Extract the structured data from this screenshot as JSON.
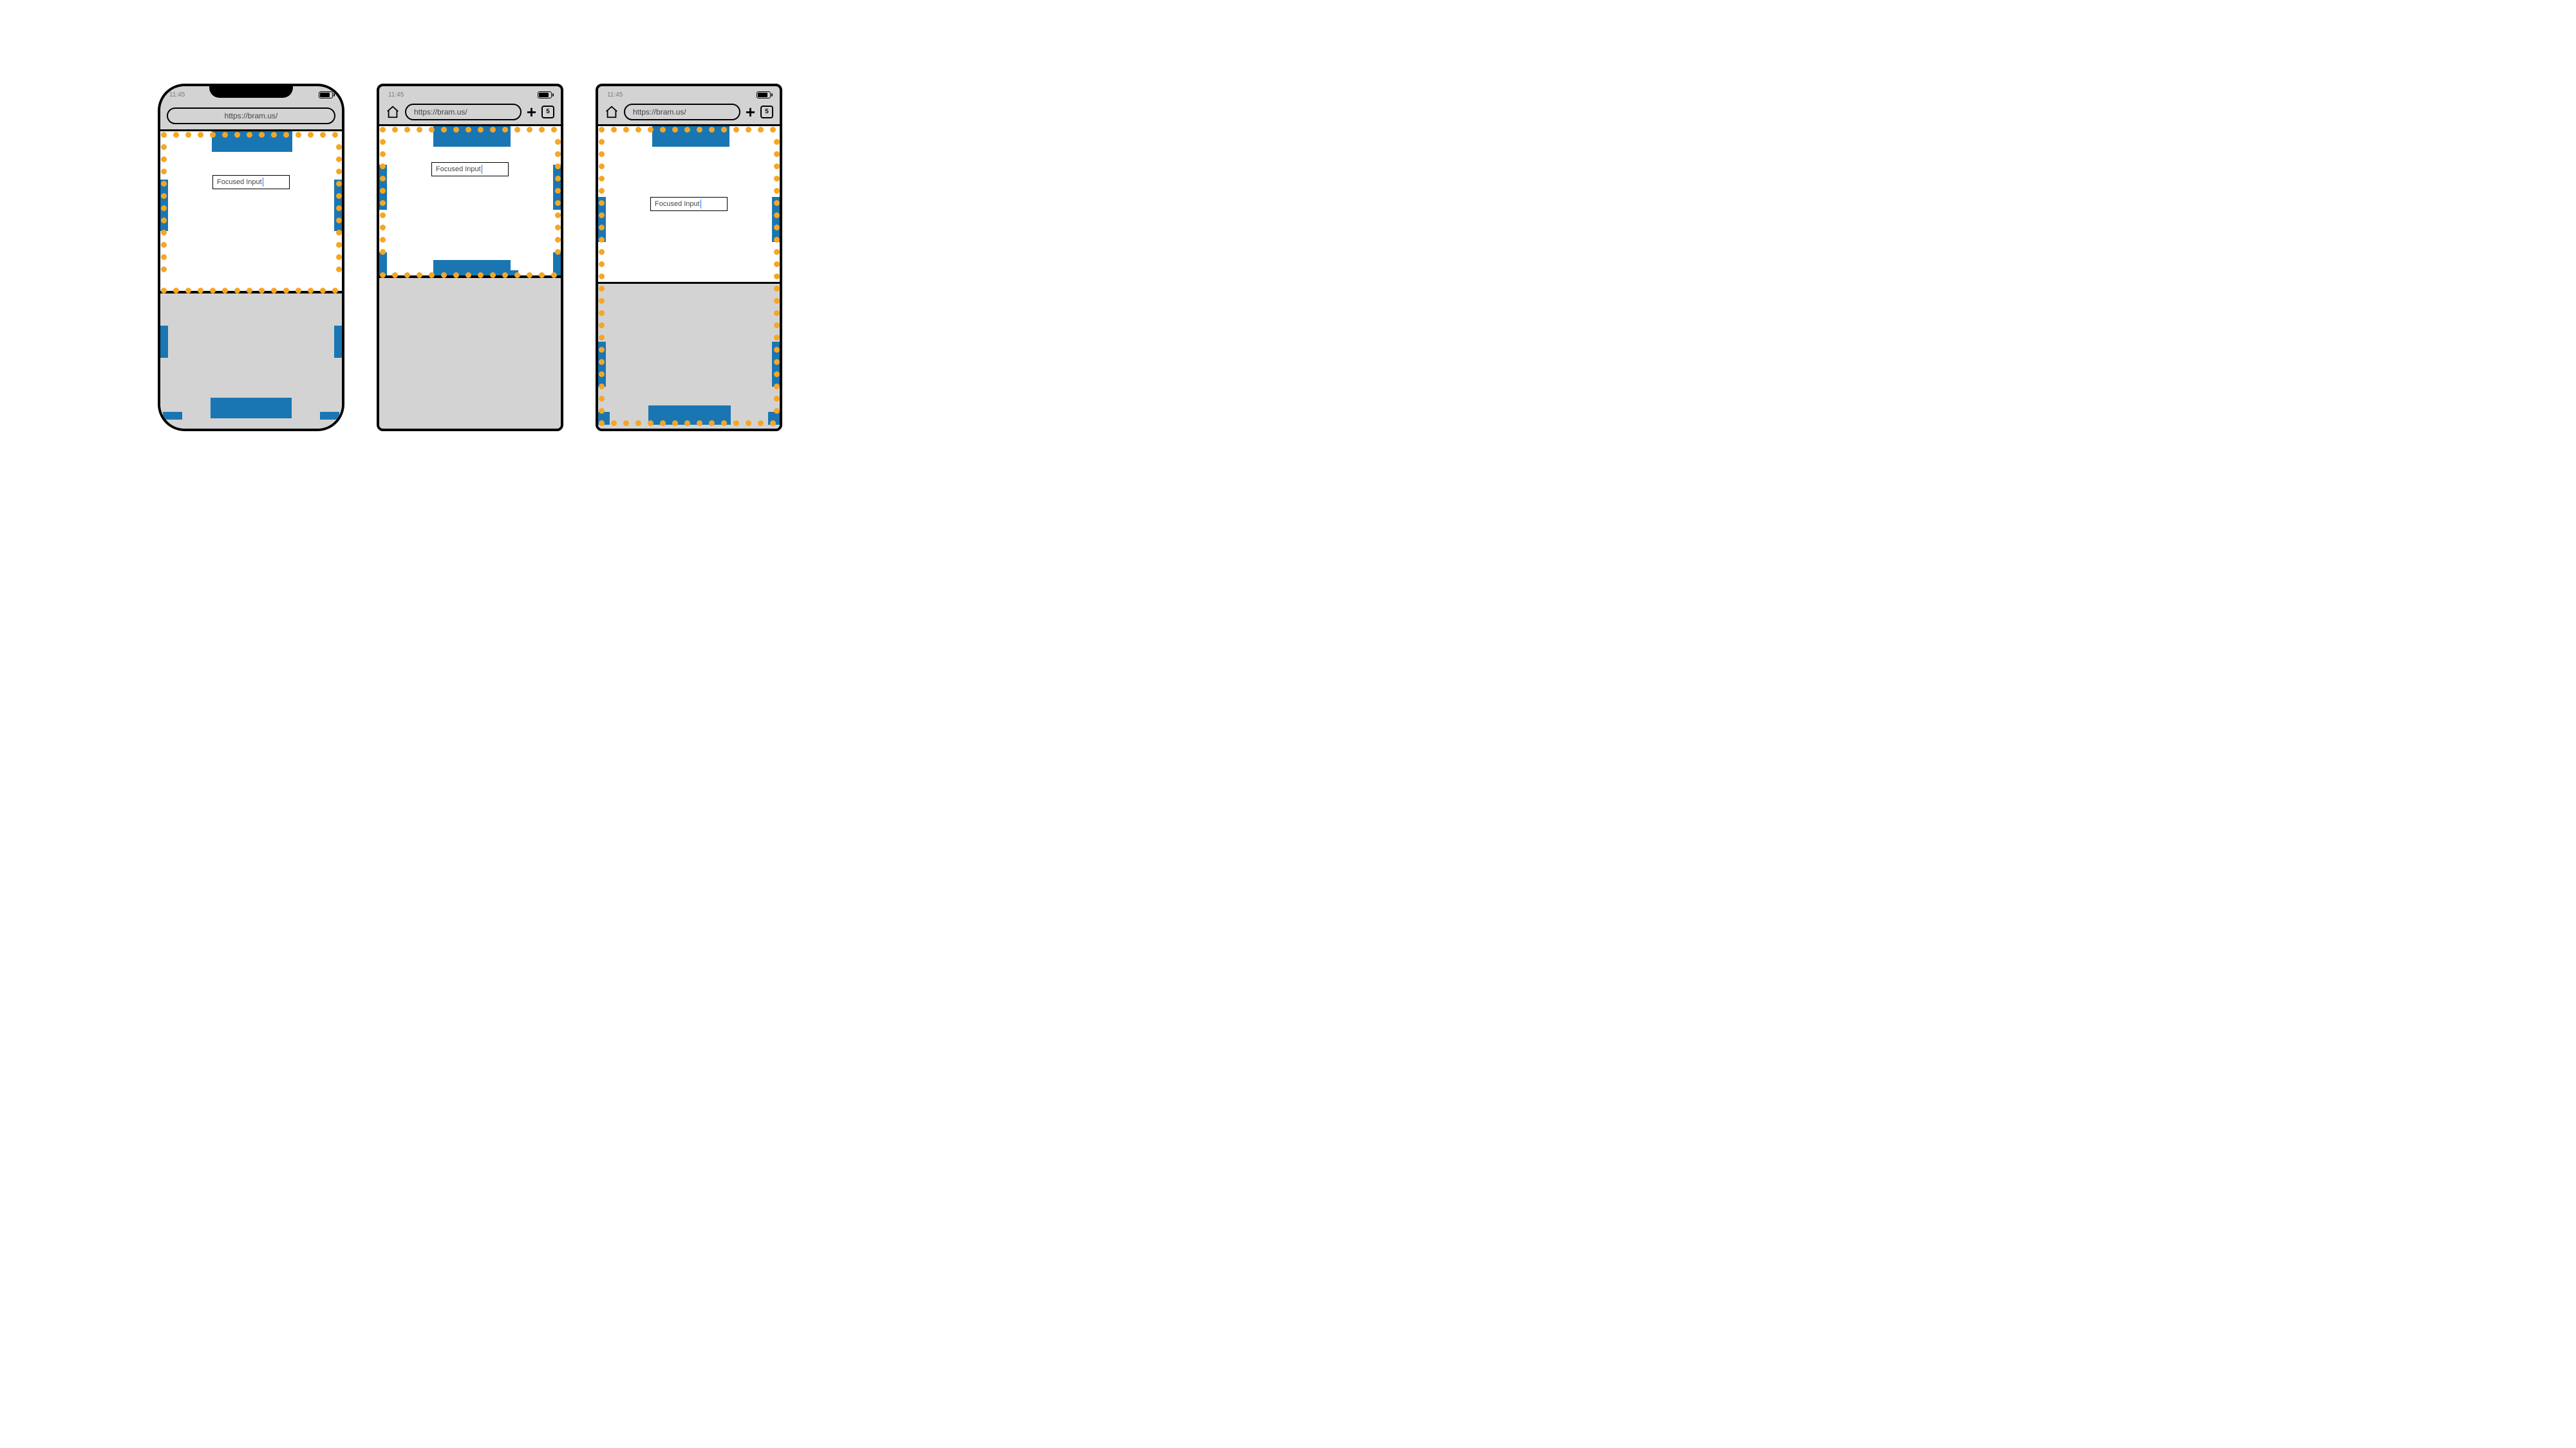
{
  "status": {
    "time": "11:45"
  },
  "browser": {
    "url": "https://bram.us/",
    "tab_count": "5"
  },
  "input": {
    "value": "Focused Input"
  },
  "colors": {
    "accent": "#1976b2",
    "dot": "#f5a623",
    "chrome": "#d3d3d3"
  }
}
